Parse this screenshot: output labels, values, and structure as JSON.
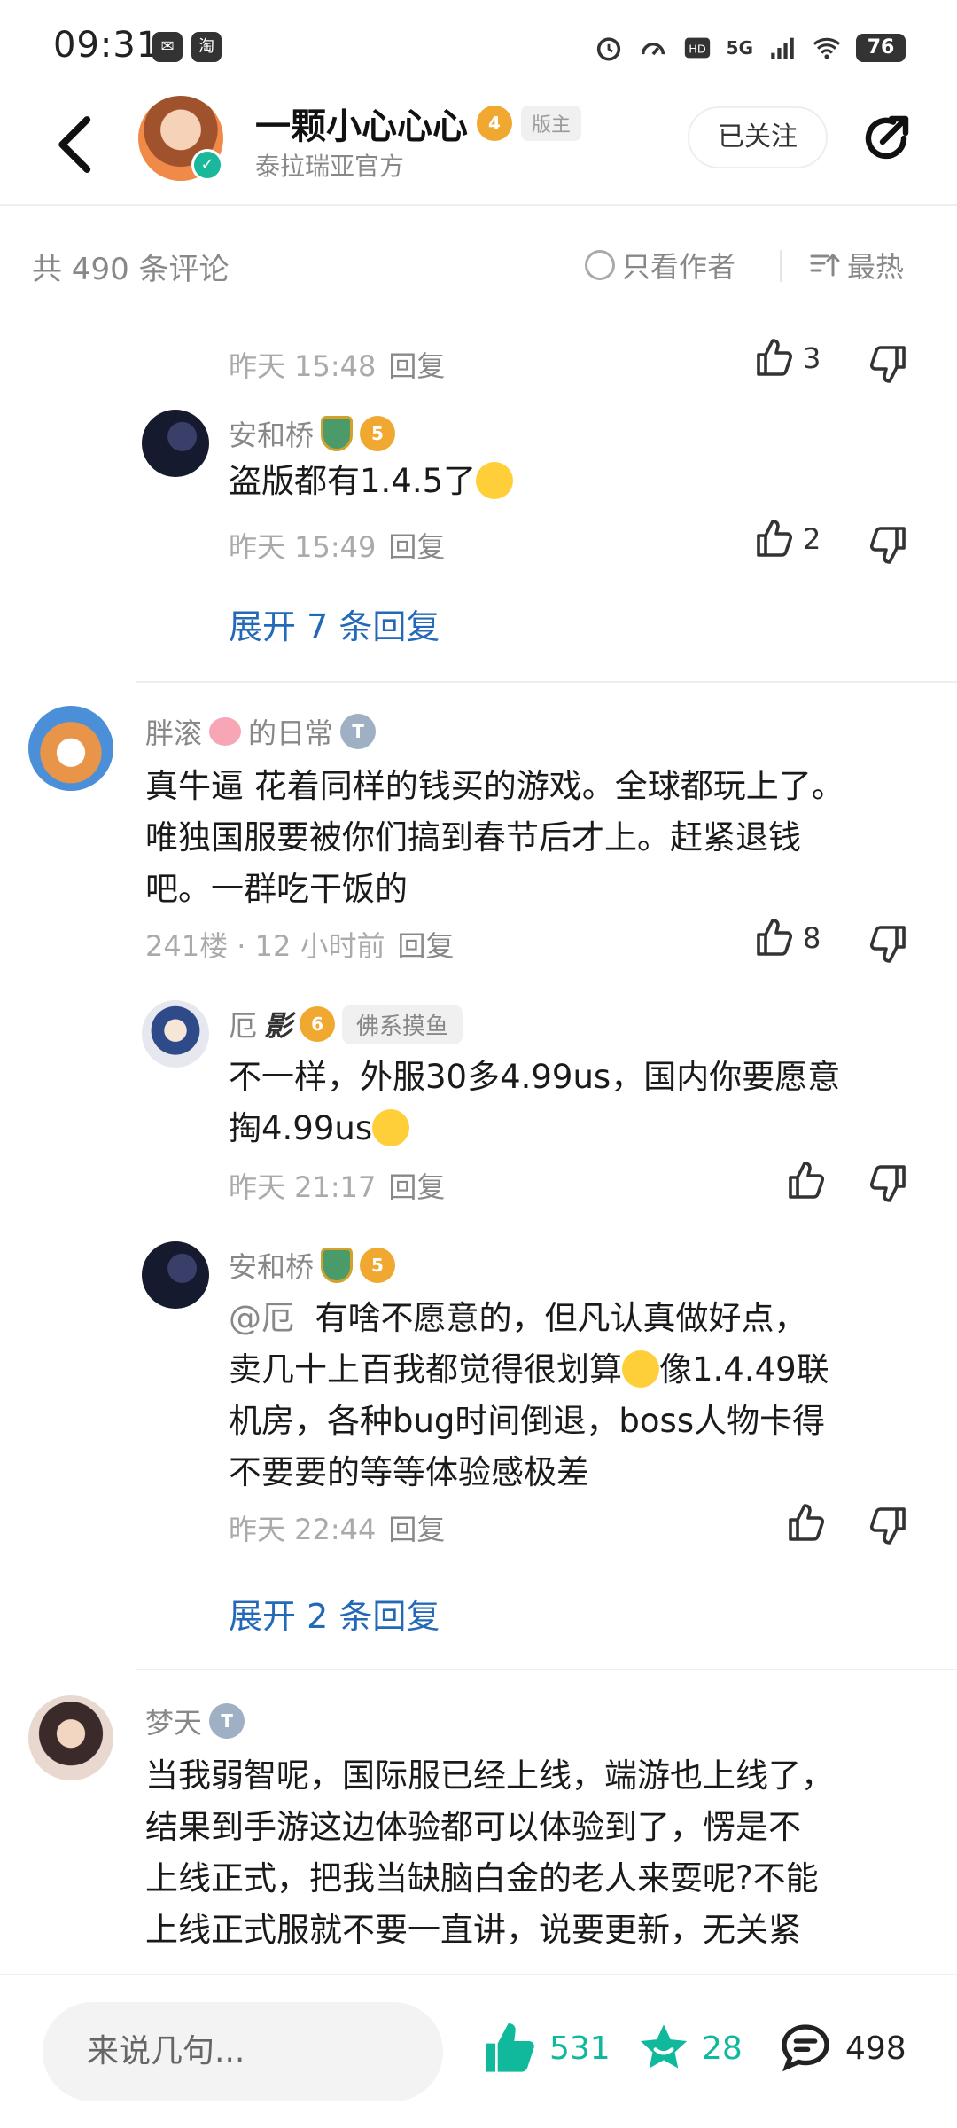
{
  "status_bar": {
    "time": "09:31",
    "app_icon_2": "淘",
    "network": "5G",
    "battery": "76"
  },
  "header": {
    "author_name": "一颗小心心心",
    "author_level": "4",
    "mod_tag": "版主",
    "author_subtitle": "泰拉瑞亚官方",
    "follow_label": "已关注"
  },
  "comment_bar": {
    "count_text": "共 490 条评论",
    "only_author": "只看作者",
    "sort_label": "最热"
  },
  "comments": [
    {
      "meta_time": "昨天 15:48",
      "reply_label": "回复",
      "likes": "3"
    },
    {
      "username": "安和桥",
      "level": "5",
      "text": "盗版都有1.4.5了",
      "meta_time": "昨天 15:49",
      "reply_label": "回复",
      "likes": "2"
    },
    {
      "expand_label": "展开 7 条回复"
    },
    {
      "username_pre": "胖滚",
      "username_post": "的日常",
      "text_lines": [
        "真牛逼 花着同样的钱买的游戏。全球都玩上了。",
        "唯独国服要被你们搞到春节后才上。赶紧退钱",
        "吧。一群吃干饭的"
      ],
      "floor": "241楼 · 12 小时前",
      "reply_label": "回复",
      "likes": "8"
    },
    {
      "username": "厄",
      "username_art": "影",
      "level": "6",
      "tag": "佛系摸鱼",
      "text_lines": [
        "不一样，外服30多4.99us，国内你要愿意",
        "掏4.99us"
      ],
      "meta_time": "昨天 21:17",
      "reply_label": "回复"
    },
    {
      "username": "安和桥",
      "level": "5",
      "mention": "@厄",
      "text_lines": [
        "有啥不愿意的，但凡认真做好点，",
        "卖几十上百我都觉得很划算",
        "像1.4.49联",
        "机房，各种bug时间倒退，boss人物卡得",
        "不要要的等等体验感极差"
      ],
      "meta_time": "昨天 22:44",
      "reply_label": "回复"
    },
    {
      "expand_label": "展开 2 条回复"
    },
    {
      "username": "梦天",
      "text_lines": [
        "当我弱智呢，国际服已经上线，端游也上线了，",
        "结果到手游这边体验都可以体验到了，愣是不",
        "上线正式，把我当缺脑白金的老人来耍呢?不能",
        "上线正式服就不要一直讲，说要更新，无关紧"
      ]
    }
  ],
  "bottom_bar": {
    "input_placeholder": "来说几句...",
    "likes": "531",
    "favorites": "28",
    "comments": "498"
  },
  "colors": {
    "link_blue": "#2468b8",
    "accent_green": "#10b99c",
    "level_gold": "#f0a830"
  }
}
